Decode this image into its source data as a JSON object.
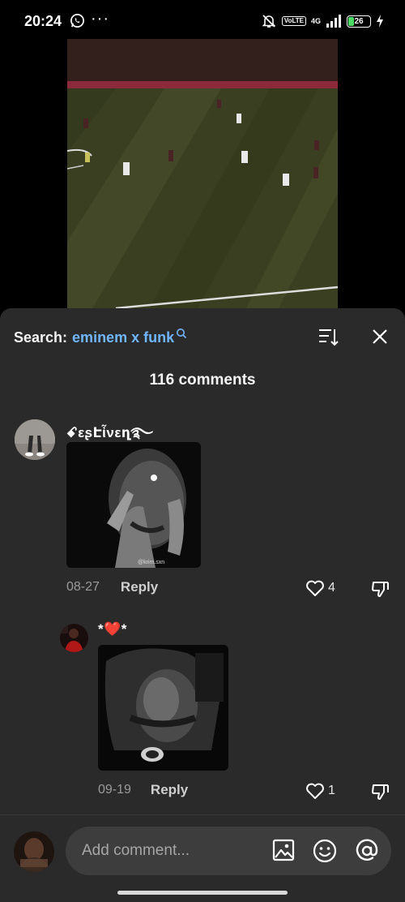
{
  "status": {
    "time": "20:24",
    "dots": "···",
    "volte": "Vo​LTE",
    "network": "4G",
    "battery": "26"
  },
  "search": {
    "label": "Search:",
    "term": "eminem x funk"
  },
  "comments_header": "116 comments",
  "comments": [
    {
      "username": "ꗃεʂԷἶνεղ࿐",
      "image_watermark": "@krim.sxn",
      "date": "08-27",
      "reply_label": "Reply",
      "likes": "4"
    },
    {
      "username": "*❤️*",
      "date": "09-19",
      "reply_label": "Reply",
      "likes": "1"
    }
  ],
  "composer": {
    "placeholder": "Add comment..."
  },
  "colors": {
    "accent_link": "#6fb6ff",
    "sheet_bg": "#2a2a2a",
    "input_bg": "#3d3d3d"
  }
}
